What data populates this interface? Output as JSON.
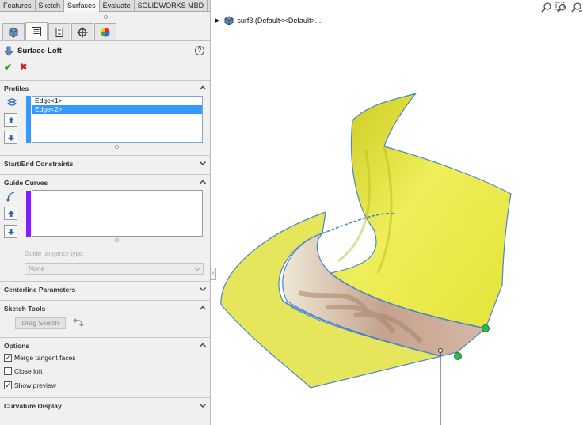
{
  "tabs": [
    {
      "label": "Features",
      "active": false
    },
    {
      "label": "Sketch",
      "active": false
    },
    {
      "label": "Surfaces",
      "active": true
    },
    {
      "label": "Evaluate",
      "active": false
    },
    {
      "label": "SOLIDWORKS MBD",
      "active": false
    }
  ],
  "property_manager": {
    "title": "Surface-Loft",
    "help": "?",
    "ok": "✔",
    "cancel": "✖"
  },
  "profiles": {
    "header": "Profiles",
    "items": [
      "Edge<1>",
      "Edge<2>"
    ],
    "selected_index": 1
  },
  "start_end": {
    "header": "Start/End Constraints"
  },
  "guide_curves": {
    "header": "Guide Curves",
    "tangency_label": "Guide tangency type:",
    "tangency_value": "None"
  },
  "centerline": {
    "header": "Centerline Parameters"
  },
  "sketch_tools": {
    "header": "Sketch Tools",
    "drag_label": "Drag Sketch"
  },
  "options": {
    "header": "Options",
    "items": [
      {
        "label": "Merge tangent faces",
        "checked": true
      },
      {
        "label": "Close loft",
        "checked": false
      },
      {
        "label": "Show preview",
        "checked": true
      }
    ]
  },
  "curvature": {
    "header": "Curvature Display"
  },
  "viewport": {
    "tree_label": "surf3  (Default<<Default>..."
  },
  "colors": {
    "surface_yellow": "#e8e84a",
    "surface_inner": "#c9a893",
    "edge_blue": "#4a86c8",
    "selection_blue": "#3399ff",
    "guide_purple": "#8a1aff",
    "handle_green": "#2db84a"
  }
}
